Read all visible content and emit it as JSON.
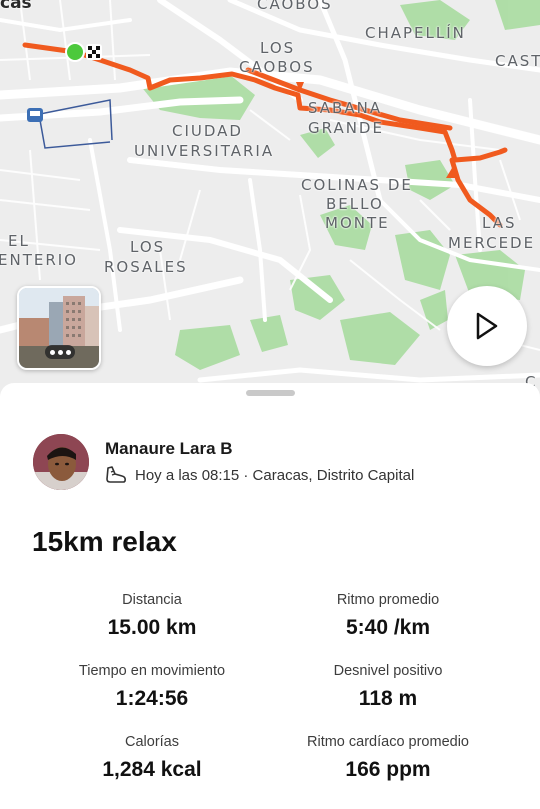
{
  "map": {
    "labels": {
      "caracas_partial": "cas",
      "caobos_top": "CAOBOS",
      "chapellin": "CHAPELLÍN",
      "los_caobos_1": "LOS",
      "los_caobos_2": "CAOBOS",
      "cast": "CAST",
      "sabana_1": "SABANA",
      "sabana_2": "GRANDE",
      "ciudad_1": "CIUDAD",
      "ciudad_2": "UNIVERSITARIA",
      "colinas_1": "COLINAS DE",
      "colinas_2": "BELLO",
      "colinas_3": "MONTE",
      "las": "LAS",
      "mercedes": "MERCEDE",
      "el": "EL",
      "cementerio": "ENTERIO",
      "los_rosales_1": "LOS",
      "los_rosales_2": "ROSALES",
      "edge_c": "C"
    },
    "route_color": "#f05a1e",
    "start_marker_color": "#4cc93c",
    "play_icon": "play-icon",
    "photos_more_icon": "more-dots-icon"
  },
  "athlete": {
    "name": "Manaure Lara B",
    "meta": "Hoy a las 08:15 · Caracas, Distrito Capital",
    "activity_icon": "running-shoe-icon"
  },
  "activity": {
    "title": "15km relax"
  },
  "stats": [
    {
      "label": "Distancia",
      "value": "15.00 km"
    },
    {
      "label": "Ritmo promedio",
      "value": "5:40 /km"
    },
    {
      "label": "Tiempo en movimiento",
      "value": "1:24:56"
    },
    {
      "label": "Desnivel positivo",
      "value": "118 m"
    },
    {
      "label": "Calorías",
      "value": "1,284 kcal"
    },
    {
      "label": "Ritmo cardíaco promedio",
      "value": "166 ppm"
    }
  ]
}
